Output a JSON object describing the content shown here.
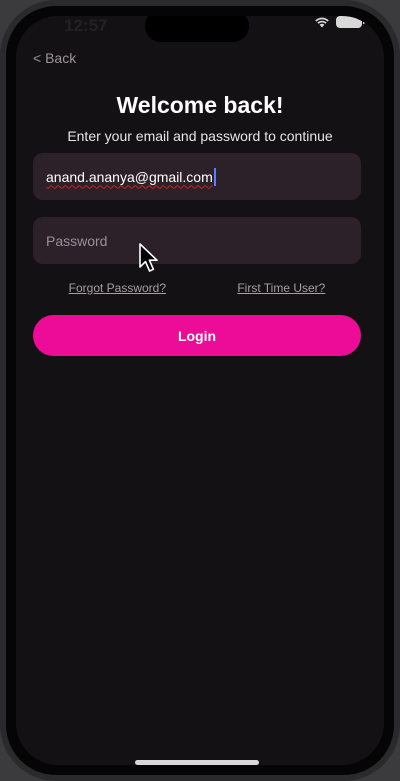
{
  "status_bar": {
    "time": "12:57"
  },
  "nav": {
    "back_label": "< Back"
  },
  "header": {
    "title": "Welcome back!",
    "subtitle": "Enter your email and password to continue"
  },
  "form": {
    "email_value": "anand.ananya@gmail.com",
    "password_placeholder": "Password",
    "forgot_password_label": "Forgot Password?",
    "first_time_user_label": "First Time User?",
    "login_label": "Login"
  },
  "colors": {
    "accent": "#ec0c97",
    "background": "#141114",
    "field_background": "#2c2128"
  },
  "icons": [
    "wifi-icon",
    "battery-icon",
    "mouse-pointer-icon"
  ]
}
